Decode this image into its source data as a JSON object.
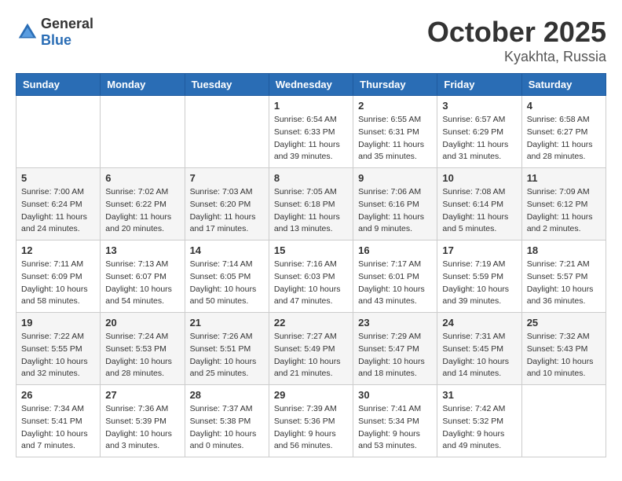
{
  "header": {
    "logo": {
      "general": "General",
      "blue": "Blue"
    },
    "month": "October 2025",
    "location": "Kyakhta, Russia"
  },
  "weekdays": [
    "Sunday",
    "Monday",
    "Tuesday",
    "Wednesday",
    "Thursday",
    "Friday",
    "Saturday"
  ],
  "weeks": [
    [
      {
        "day": "",
        "info": ""
      },
      {
        "day": "",
        "info": ""
      },
      {
        "day": "",
        "info": ""
      },
      {
        "day": "1",
        "info": "Sunrise: 6:54 AM\nSunset: 6:33 PM\nDaylight: 11 hours\nand 39 minutes."
      },
      {
        "day": "2",
        "info": "Sunrise: 6:55 AM\nSunset: 6:31 PM\nDaylight: 11 hours\nand 35 minutes."
      },
      {
        "day": "3",
        "info": "Sunrise: 6:57 AM\nSunset: 6:29 PM\nDaylight: 11 hours\nand 31 minutes."
      },
      {
        "day": "4",
        "info": "Sunrise: 6:58 AM\nSunset: 6:27 PM\nDaylight: 11 hours\nand 28 minutes."
      }
    ],
    [
      {
        "day": "5",
        "info": "Sunrise: 7:00 AM\nSunset: 6:24 PM\nDaylight: 11 hours\nand 24 minutes."
      },
      {
        "day": "6",
        "info": "Sunrise: 7:02 AM\nSunset: 6:22 PM\nDaylight: 11 hours\nand 20 minutes."
      },
      {
        "day": "7",
        "info": "Sunrise: 7:03 AM\nSunset: 6:20 PM\nDaylight: 11 hours\nand 17 minutes."
      },
      {
        "day": "8",
        "info": "Sunrise: 7:05 AM\nSunset: 6:18 PM\nDaylight: 11 hours\nand 13 minutes."
      },
      {
        "day": "9",
        "info": "Sunrise: 7:06 AM\nSunset: 6:16 PM\nDaylight: 11 hours\nand 9 minutes."
      },
      {
        "day": "10",
        "info": "Sunrise: 7:08 AM\nSunset: 6:14 PM\nDaylight: 11 hours\nand 5 minutes."
      },
      {
        "day": "11",
        "info": "Sunrise: 7:09 AM\nSunset: 6:12 PM\nDaylight: 11 hours\nand 2 minutes."
      }
    ],
    [
      {
        "day": "12",
        "info": "Sunrise: 7:11 AM\nSunset: 6:09 PM\nDaylight: 10 hours\nand 58 minutes."
      },
      {
        "day": "13",
        "info": "Sunrise: 7:13 AM\nSunset: 6:07 PM\nDaylight: 10 hours\nand 54 minutes."
      },
      {
        "day": "14",
        "info": "Sunrise: 7:14 AM\nSunset: 6:05 PM\nDaylight: 10 hours\nand 50 minutes."
      },
      {
        "day": "15",
        "info": "Sunrise: 7:16 AM\nSunset: 6:03 PM\nDaylight: 10 hours\nand 47 minutes."
      },
      {
        "day": "16",
        "info": "Sunrise: 7:17 AM\nSunset: 6:01 PM\nDaylight: 10 hours\nand 43 minutes."
      },
      {
        "day": "17",
        "info": "Sunrise: 7:19 AM\nSunset: 5:59 PM\nDaylight: 10 hours\nand 39 minutes."
      },
      {
        "day": "18",
        "info": "Sunrise: 7:21 AM\nSunset: 5:57 PM\nDaylight: 10 hours\nand 36 minutes."
      }
    ],
    [
      {
        "day": "19",
        "info": "Sunrise: 7:22 AM\nSunset: 5:55 PM\nDaylight: 10 hours\nand 32 minutes."
      },
      {
        "day": "20",
        "info": "Sunrise: 7:24 AM\nSunset: 5:53 PM\nDaylight: 10 hours\nand 28 minutes."
      },
      {
        "day": "21",
        "info": "Sunrise: 7:26 AM\nSunset: 5:51 PM\nDaylight: 10 hours\nand 25 minutes."
      },
      {
        "day": "22",
        "info": "Sunrise: 7:27 AM\nSunset: 5:49 PM\nDaylight: 10 hours\nand 21 minutes."
      },
      {
        "day": "23",
        "info": "Sunrise: 7:29 AM\nSunset: 5:47 PM\nDaylight: 10 hours\nand 18 minutes."
      },
      {
        "day": "24",
        "info": "Sunrise: 7:31 AM\nSunset: 5:45 PM\nDaylight: 10 hours\nand 14 minutes."
      },
      {
        "day": "25",
        "info": "Sunrise: 7:32 AM\nSunset: 5:43 PM\nDaylight: 10 hours\nand 10 minutes."
      }
    ],
    [
      {
        "day": "26",
        "info": "Sunrise: 7:34 AM\nSunset: 5:41 PM\nDaylight: 10 hours\nand 7 minutes."
      },
      {
        "day": "27",
        "info": "Sunrise: 7:36 AM\nSunset: 5:39 PM\nDaylight: 10 hours\nand 3 minutes."
      },
      {
        "day": "28",
        "info": "Sunrise: 7:37 AM\nSunset: 5:38 PM\nDaylight: 10 hours\nand 0 minutes."
      },
      {
        "day": "29",
        "info": "Sunrise: 7:39 AM\nSunset: 5:36 PM\nDaylight: 9 hours\nand 56 minutes."
      },
      {
        "day": "30",
        "info": "Sunrise: 7:41 AM\nSunset: 5:34 PM\nDaylight: 9 hours\nand 53 minutes."
      },
      {
        "day": "31",
        "info": "Sunrise: 7:42 AM\nSunset: 5:32 PM\nDaylight: 9 hours\nand 49 minutes."
      },
      {
        "day": "",
        "info": ""
      }
    ]
  ]
}
